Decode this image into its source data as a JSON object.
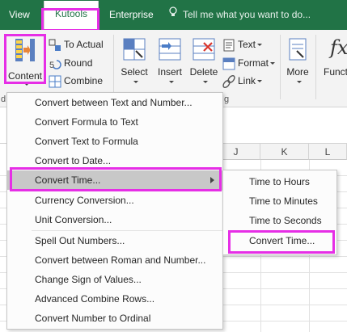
{
  "tabs": {
    "view": "View",
    "kutools": "Kutools",
    "enterprise": "Enterprise",
    "tell_me": "Tell me what you want to do..."
  },
  "ribbon": {
    "content": "Content",
    "to_actual": "To Actual",
    "round": "Round",
    "combine": "Combine",
    "select": "Select",
    "insert": "Insert",
    "delete": "Delete",
    "text": "Text",
    "format": "Format",
    "link": "Link",
    "more": "More",
    "functions": "Functi",
    "group_edit_fragment": "g",
    "group_left_fragment": "d"
  },
  "columns": [
    "J",
    "K",
    "L"
  ],
  "content_menu": [
    "Convert between Text and Number...",
    "Convert Formula to Text",
    "Convert Text to Formula",
    "Convert to Date...",
    "Convert Time...",
    "Currency Conversion...",
    "Unit Conversion...",
    "Spell Out Numbers...",
    "Convert between Roman and Number...",
    "Change Sign of Values...",
    "Advanced Combine Rows...",
    "Convert Number to Ordinal"
  ],
  "time_submenu": [
    "Time to Hours",
    "Time to Minutes",
    "Time to Seconds",
    "Convert Time..."
  ],
  "colors": {
    "ribbon_green": "#217346",
    "highlight_magenta": "#e62ee6",
    "active_item": "#c8c8c8"
  }
}
